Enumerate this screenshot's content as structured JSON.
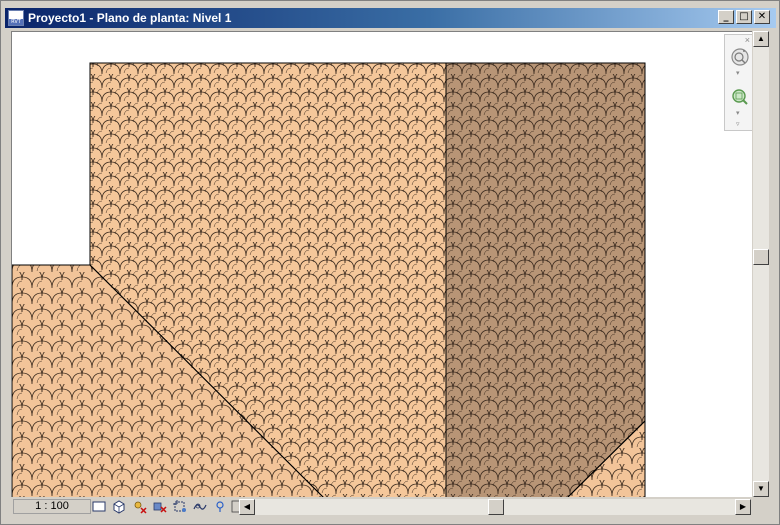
{
  "window": {
    "title": "Proyecto1 - Plano de planta: Nivel 1",
    "app_icon_text": "RVT",
    "minimize": "_",
    "maximize": "□",
    "close": "✕"
  },
  "navigation_bar": {
    "close": "×",
    "tools": [
      "steering-wheel-icon",
      "zoom-region-icon"
    ]
  },
  "status_bar": {
    "view_scale": "1 : 100",
    "view_controls": [
      "detail-level-icon",
      "visual-style-icon",
      "sun-path-icon",
      "shadows-icon",
      "crop-view-icon",
      "show-crop-region-icon",
      "temporary-hide-icon",
      "reveal-hidden-icon"
    ]
  },
  "scrollbars": {
    "up": "▲",
    "down": "▼",
    "left": "◀",
    "right": "▶"
  },
  "colors": {
    "roof_light": "#f5c79a",
    "roof_shadow": "#b89576",
    "roof_sloped": "#f2c499",
    "tile_stroke": "#3a2a1e",
    "titlebar_start": "#0a246a",
    "titlebar_end": "#a6caf0"
  }
}
